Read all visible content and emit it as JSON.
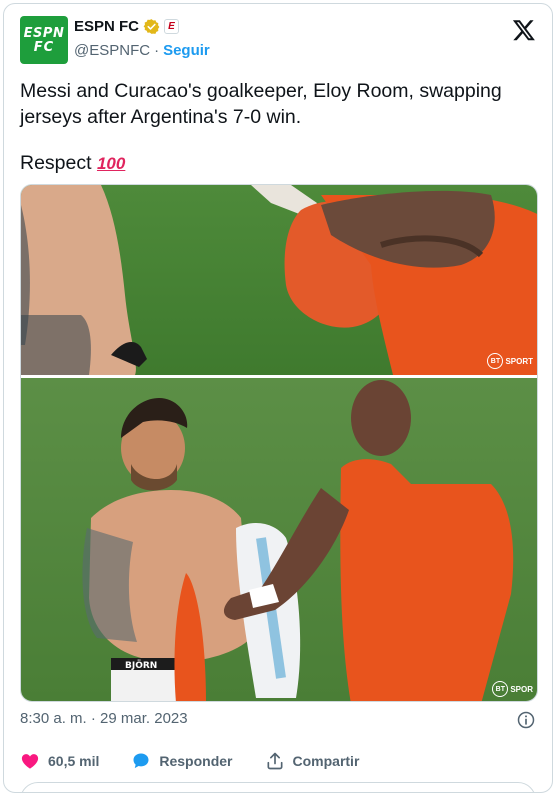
{
  "account": {
    "display_name": "ESPN FC",
    "avatar_line1": "ESPN",
    "avatar_line2": "FC",
    "handle": "@ESPNFC",
    "separator": "·",
    "follow_label": "Seguir",
    "affiliate_badge": "E",
    "verified_color": "#e2b719",
    "brand_color": "#1e9e3c"
  },
  "tweet": {
    "line1": "Messi and Curacao's goalkeeper, Eloy Room, swapping jerseys after Argentina's 7-0 win.",
    "line2_text": "Respect",
    "line2_emoji": "100"
  },
  "media": {
    "watermark_top": "SPORT",
    "watermark_top_badge": "BT",
    "watermark_bottom": "SPOR",
    "watermark_bottom_badge": "BT",
    "waistband_text": "BJÖRN"
  },
  "meta": {
    "timestamp": "8:30 a. m. · 29 mar. 2023"
  },
  "actions": {
    "likes": "60,5 mil",
    "reply_label": "Responder",
    "share_label": "Compartir",
    "like_color": "#f91880",
    "reply_color": "#1d9bf0"
  },
  "icons": {
    "logo": "x-logo-icon",
    "verified": "verified-check-icon",
    "info": "info-icon",
    "like": "heart-icon",
    "reply": "speech-bubble-icon",
    "share": "share-upload-icon"
  }
}
